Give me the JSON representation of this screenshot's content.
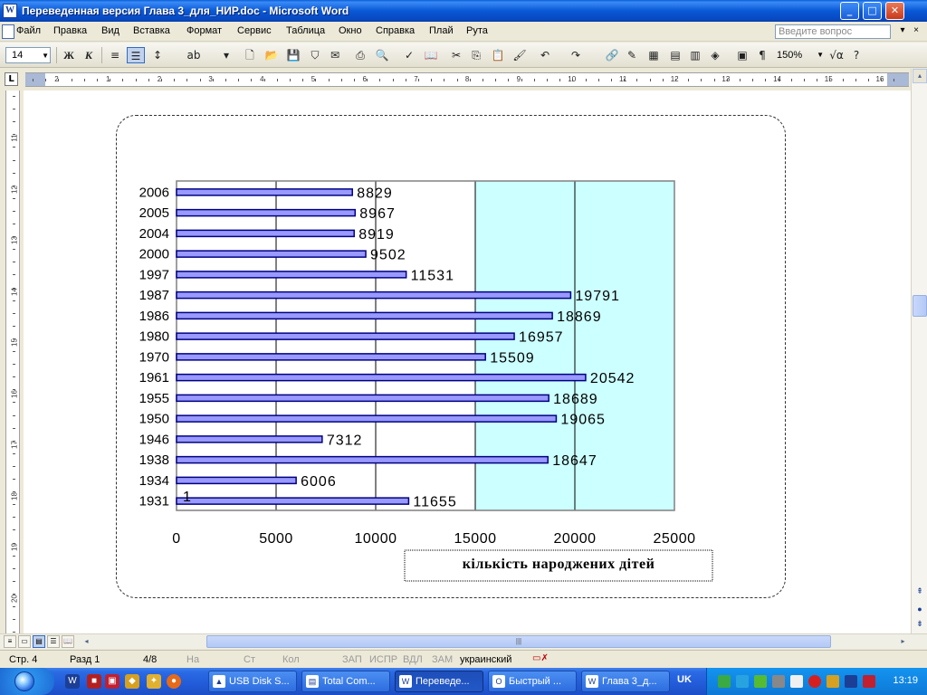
{
  "window": {
    "title": "Переведенная версия Глава 3_для_НИР.doc - Microsoft Word",
    "app_icon": "W",
    "buttons": {
      "minimize": "_",
      "maximize": "□",
      "close": "✕"
    },
    "doc_close": "×"
  },
  "menu": {
    "items": [
      "Файл",
      "Правка",
      "Вид",
      "Вставка",
      "Формат",
      "Сервис",
      "Таблица",
      "Окно",
      "Справка",
      "Плай",
      "Рута"
    ],
    "help_placeholder": "Введите вопрос",
    "sub_buttons": [
      "▾",
      "×"
    ]
  },
  "toolbar": {
    "font_size": "14",
    "bold": "Ж",
    "italic": "К",
    "zoom": "150%",
    "paragraph": "¶",
    "icons": [
      "align-left-icon",
      "justify-icon",
      "line-spacing-icon",
      "spelling-icon",
      "new-icon",
      "open-icon",
      "save-icon",
      "permission-icon",
      "print-icon",
      "preview-icon",
      "spellcheck-icon",
      "research-icon",
      "cut-icon",
      "copy-icon",
      "paste-icon",
      "format-painter-icon",
      "undo-icon",
      "redo-icon",
      "hyperlink-icon",
      "tables-borders-icon",
      "insert-table-icon",
      "insert-excel-icon",
      "columns-icon",
      "drawing-icon",
      "doc-map-icon",
      "help-icon"
    ]
  },
  "ruler": {
    "tab_selector": "L",
    "h_numbers": [
      "1",
      "2",
      "1",
      "2",
      "3",
      "4",
      "5",
      "6",
      "7",
      "8",
      "9",
      "10",
      "11",
      "12",
      "13",
      "14",
      "15",
      "16"
    ],
    "v_numbers": [
      "11",
      "12",
      "13",
      "14",
      "15",
      "16",
      "17",
      "18",
      "19",
      "20"
    ]
  },
  "chart_data": {
    "type": "bar",
    "orientation": "horizontal",
    "categories": [
      "2006",
      "2005",
      "2004",
      "2000",
      "1997",
      "1987",
      "1986",
      "1980",
      "1970",
      "1961",
      "1955",
      "1950",
      "1946",
      "1938",
      "1934",
      "1931"
    ],
    "values": [
      8829,
      8967,
      8919,
      9502,
      11531,
      19791,
      18869,
      16957,
      15509,
      20542,
      18689,
      19065,
      7312,
      18647,
      6006,
      11655
    ],
    "data_labels": [
      "8829",
      "8967",
      "8919",
      "9502",
      "11531",
      "19791",
      "18869",
      "16957",
      "15509",
      "20542",
      "18689",
      "19065",
      "7312",
      "18647",
      "6006",
      "11655"
    ],
    "stray_label": "1",
    "xlim": [
      0,
      25000
    ],
    "x_ticks": [
      "0",
      "5000",
      "10000",
      "15000",
      "20000",
      "25000"
    ],
    "xlabel": "кількість народжених дітей",
    "ylabel": "",
    "title": "",
    "grid": true,
    "legend": "none",
    "colors": {
      "bar": "#9999ff",
      "bar_border": "#000080",
      "plot_bg": "#ccffff"
    }
  },
  "statusbar": {
    "page": "Стр. 4",
    "section": "Разд 1",
    "page_of": "4/8",
    "at": "На",
    "line": "Ст",
    "col": "Кол",
    "rec": "ЗАП",
    "trk": "ИСПР",
    "ext": "ВДЛ",
    "ovr": "ЗАМ",
    "language": "украинский"
  },
  "hscroll": {
    "left": "◂",
    "right": "▸",
    "grip": "|||"
  },
  "vscroll": {
    "up": "▴",
    "down": "▾",
    "prev_page": "⇞",
    "browse": "●",
    "next_page": "⇟"
  },
  "taskbar": {
    "tasks": [
      "USB Disk S...",
      "Total Com...",
      "Переведе...",
      "Быстрый ...",
      "Глава 3_д..."
    ],
    "language": "UK",
    "time": "13:19"
  }
}
